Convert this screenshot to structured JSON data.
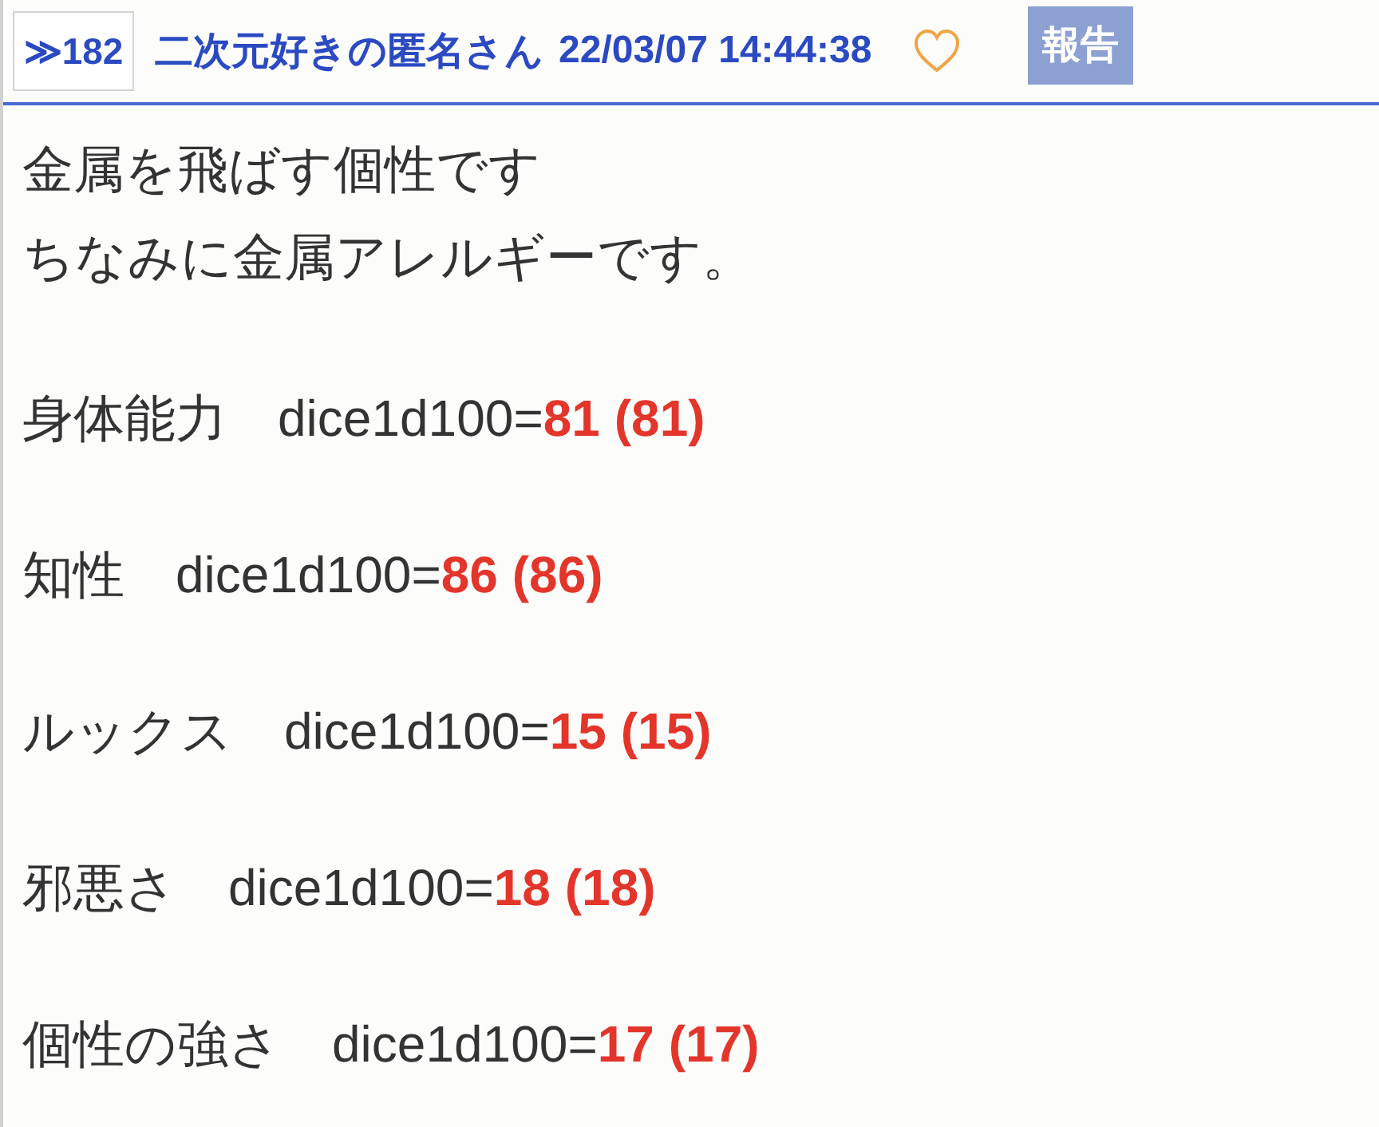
{
  "post": {
    "number": "≫182",
    "author": "二次元好きの匿名さん",
    "date": "22/03/07 14:44:38",
    "report_button": "報告"
  },
  "body": [
    {
      "kind": "text",
      "lines": [
        "金属を飛ばす個性です",
        "ちなみに金属アレルギーです。"
      ]
    },
    {
      "kind": "dice",
      "text": "身体能力　dice1d100=",
      "result": "81 (81)"
    },
    {
      "kind": "dice",
      "text": "知性　dice1d100=",
      "result": "86 (86)"
    },
    {
      "kind": "dice",
      "text": "ルックス　dice1d100=",
      "result": "15 (15)"
    },
    {
      "kind": "dice",
      "text": "邪悪さ　dice1d100=",
      "result": "18 (18)"
    },
    {
      "kind": "dice",
      "text": "個性の強さ　dice1d100=",
      "result": "17 (17)"
    }
  ]
}
